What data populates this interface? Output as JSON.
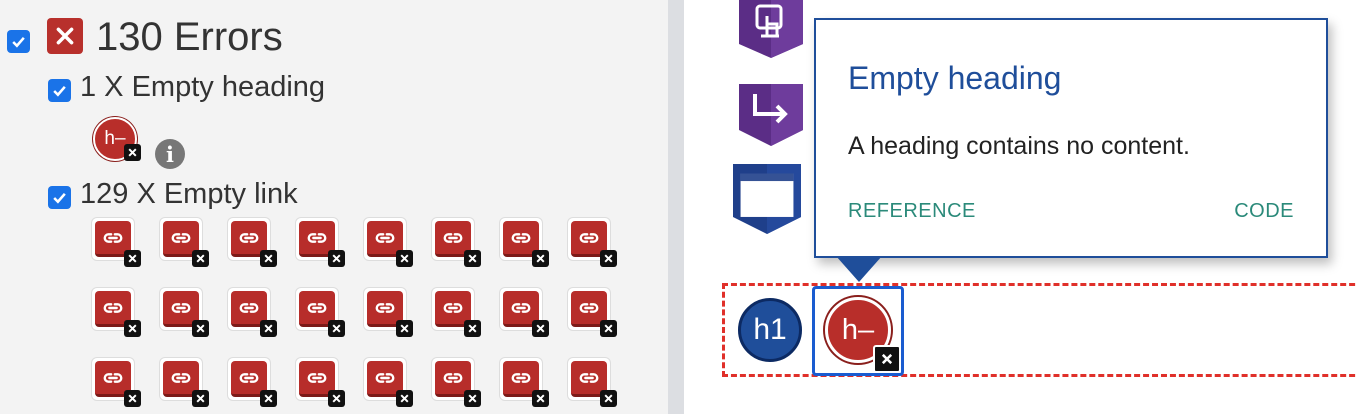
{
  "summary": {
    "title": "130 Errors",
    "checked": true
  },
  "groups": [
    {
      "label": "1 X Empty heading",
      "checked": true,
      "icon_text": "h–",
      "icon": "empty-heading-icon"
    },
    {
      "label": "129 X Empty link",
      "checked": true,
      "icon": "broken-link-icon"
    }
  ],
  "page_icons": {
    "h1_text": "h1",
    "empty_heading_text": "h–"
  },
  "popup": {
    "title": "Empty heading",
    "description": "A heading contains no content.",
    "reference_label": "REFERENCE",
    "code_label": "CODE"
  },
  "colors": {
    "error_red": "#b8302c",
    "accent_blue": "#1f4e9a",
    "link_teal": "#2b8a7a",
    "checkbox_blue": "#1a73e8",
    "dashed_outline": "#e0302a"
  }
}
